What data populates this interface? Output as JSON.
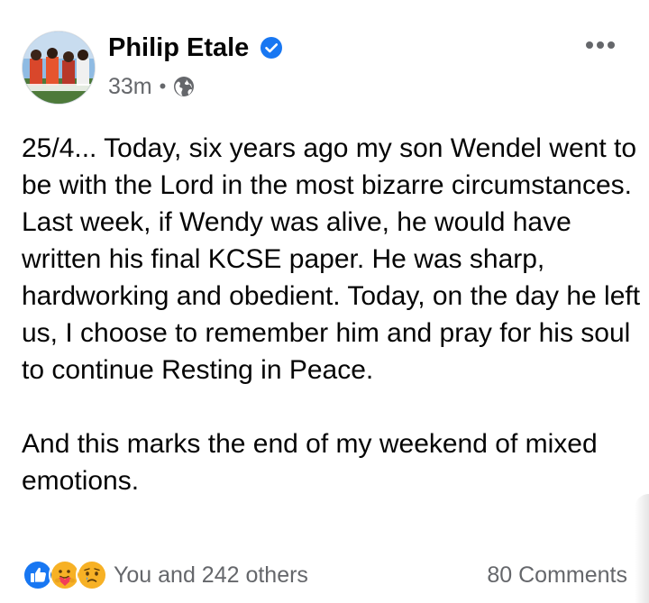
{
  "post": {
    "author_name": "Philip Etale",
    "time_ago": "33m",
    "separator": "•",
    "paragraphs": [
      "25/4... Today, six years ago my son Wendel went to be with the Lord in the most bizarre circumstances. Last week, if Wendy was alive, he would have written his final KCSE paper. He was sharp, hardworking and obedient. Today, on the day he left us, I choose to remember him and pray for his soul to continue Resting in Peace.",
      "And this marks the end of my weekend of mixed emotions."
    ],
    "verified_badge_icon": "verified-check-icon",
    "audience_icon": "globe-icon",
    "menu_icon": "more-options-icon"
  },
  "footer": {
    "reactions_label": "You and 242 others",
    "comments_label": "80 Comments",
    "reaction_icons": [
      "like-icon",
      "care-icon",
      "sad-icon"
    ]
  },
  "colors": {
    "brand_blue": "#1877f2",
    "secondary_text": "#65676b",
    "primary_text": "#050505",
    "care_yellow": "#f7b125",
    "care_heart": "#f33e58"
  }
}
